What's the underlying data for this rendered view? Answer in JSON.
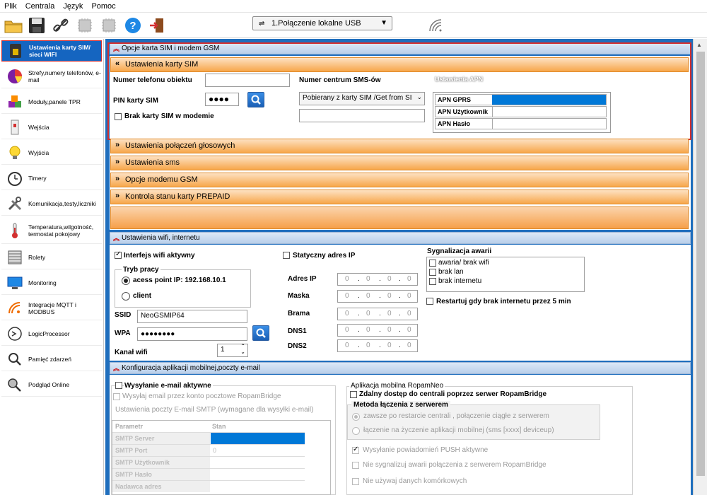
{
  "menu": [
    "Plik",
    "Centrala",
    "Język",
    "Pomoc"
  ],
  "connection": {
    "label": "1.Połączenie lokalne USB"
  },
  "sidebar": {
    "items": [
      {
        "label": "Ustawienia karty SIM/ sieci WIFI",
        "icon": "sim-card-icon",
        "active": true
      },
      {
        "label": "Strefy,numery telefonów, e-mail",
        "icon": "pie-chart-icon"
      },
      {
        "label": "Moduły,panele TPR",
        "icon": "modules-icon"
      },
      {
        "label": "Wejścia",
        "icon": "door-sensor-icon"
      },
      {
        "label": "Wyjścia",
        "icon": "lightbulb-icon"
      },
      {
        "label": "Timery",
        "icon": "clock-icon"
      },
      {
        "label": "Komunikacja,testy,liczniki",
        "icon": "tools-icon"
      },
      {
        "label": "Temperatura,wilgotność, termostat pokojowy",
        "icon": "thermometer-icon"
      },
      {
        "label": "Rolety",
        "icon": "blinds-icon"
      },
      {
        "label": "Monitoring",
        "icon": "monitoring-icon"
      },
      {
        "label": "Integracje MQTT i MODBUS",
        "icon": "integration-icon"
      },
      {
        "label": "LogicProcessor",
        "icon": "logic-icon"
      },
      {
        "label": "Pamięć zdarzeń",
        "icon": "event-log-icon"
      },
      {
        "label": "Podgląd Online",
        "icon": "online-view-icon"
      }
    ]
  },
  "sim_section": {
    "header": "Opcje karta SIM i modem GSM",
    "sim_settings_bar": "Ustawienia karty SIM",
    "phone_label": "Numer telefonu obiektu",
    "phone_value": "",
    "sms_center_label": "Numer centrum SMS-ów",
    "sms_center_select": "Pobierany z karty SIM /Get from SI",
    "sms_center_value": "",
    "pin_label": "PIN karty SIM",
    "pin_value": "●●●●",
    "no_sim_label": "Brak karty SIM w modemie",
    "apn_title": "Ustawienia APN",
    "apn_rows": [
      {
        "label": "APN GPRS",
        "value": ""
      },
      {
        "label": "APN Użytkownik",
        "value": ""
      },
      {
        "label": "APN Hasło",
        "value": ""
      }
    ],
    "bars": [
      "Ustawienia połączeń głosowych",
      "Ustawienia sms",
      "Opcje modemu GSM",
      "Kontrola stanu karty PREPAID"
    ]
  },
  "wifi_section": {
    "header": "Ustawienia wifi, internetu",
    "wifi_active_label": "Interfejs wifi aktywny",
    "mode_title": "Tryb pracy",
    "mode_ap": "acess point IP: 192.168.10.1",
    "mode_client": "client",
    "ssid_label": "SSID",
    "ssid_value": "NeoGSMIP64",
    "wpa_label": "WPA",
    "wpa_value": "●●●●●●●●",
    "channel_label": "Kanał wifi",
    "channel_value": "1",
    "static_ip_label": "Statyczny adres IP",
    "ip_fields": [
      {
        "label": "Adres IP",
        "value": [
          "0",
          "0",
          "0",
          "0"
        ]
      },
      {
        "label": "Maska",
        "value": [
          "0",
          "0",
          "0",
          "0"
        ]
      },
      {
        "label": "Brama",
        "value": [
          "0",
          "0",
          "0",
          "0"
        ]
      },
      {
        "label": "DNS1",
        "value": [
          "0",
          "0",
          "0",
          "0"
        ]
      },
      {
        "label": "DNS2",
        "value": [
          "0",
          "0",
          "0",
          "0"
        ]
      }
    ],
    "fault_title": "Sygnalizacja awarii",
    "faults": [
      "awaria/ brak wifi",
      "brak lan",
      "brak internetu"
    ],
    "restart_label": "Restartuj gdy brak internetu przez 5 min"
  },
  "mobile_section": {
    "header": "Konfiguracja aplikacji mobilnej,poczty e-mail",
    "email_active_label": "Wysyłanie e-mail aktywne",
    "email_via_label": "Wysyłaj email przez konto pocztowe RopamBridge",
    "smtp_title": "Ustawienia poczty E-mail SMTP (wymagane dla wysyłki e-mail)",
    "smtp_headers": [
      "Parametr",
      "Stan"
    ],
    "smtp_rows": [
      {
        "label": "SMTP Server",
        "value": ""
      },
      {
        "label": "SMTP Port",
        "value": "0"
      },
      {
        "label": "SMTP Użytkownik",
        "value": ""
      },
      {
        "label": "SMTP Hasło",
        "value": ""
      },
      {
        "label": "Nadawca adres",
        "value": ""
      }
    ],
    "app_title": "Aplikacja mobilna RopamNeo",
    "remote_label": "Zdalny dostęp do centrali poprzez serwer RopamBridge",
    "method_title": "Metoda łączenia z serwerem",
    "method_always": "zawsze po restarcie centrali , połączenie ciągłe z serwerem",
    "method_ondemand": "łączenie na życzenie aplikacji mobilnej  (sms [xxxx] deviceup)",
    "push_label": "Wysyłanie powiadomień PUSH aktywne",
    "no_fault_label": "Nie sygnalizuj awarii  połączenia z serwerem RopamBridge",
    "no_cellular_label": "Nie używaj danych komórkowych"
  }
}
